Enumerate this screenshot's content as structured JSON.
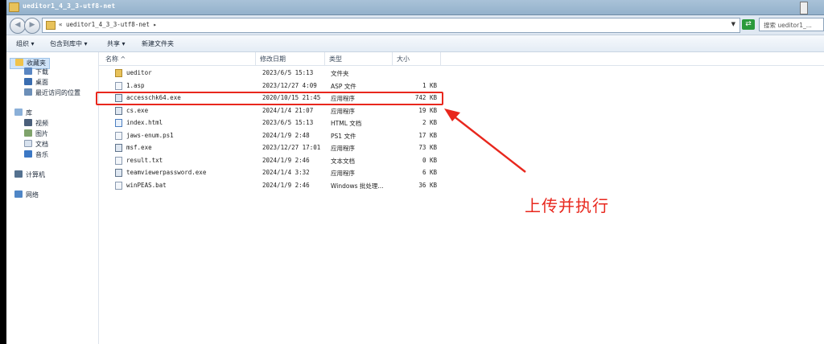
{
  "window": {
    "title": "ueditor1_4_3_3-utf8-net"
  },
  "address": {
    "path": "« ueditor1_4_3_3-utf8-net ▸",
    "search_placeholder": "搜索 ueditor1_..."
  },
  "toolbar": {
    "organize": "组织 ▾",
    "include": "包含到库中 ▾",
    "share": "共享 ▾",
    "new_folder": "新建文件夹"
  },
  "sidebar": {
    "favorites": "收藏夹",
    "downloads": "下载",
    "desktop": "桌面",
    "recent": "最近访问的位置",
    "libraries": "库",
    "videos": "视频",
    "pictures": "图片",
    "documents": "文档",
    "music": "音乐",
    "computer": "计算机",
    "network": "网络"
  },
  "columns": {
    "name": "名称 ^",
    "date": "修改日期",
    "type": "类型",
    "size": "大小"
  },
  "files": [
    {
      "name": "ueditor",
      "date": "2023/6/5 15:13",
      "type": "文件夹",
      "size": "",
      "icon": "folder-icon"
    },
    {
      "name": "1.asp",
      "date": "2023/12/27 4:09",
      "type": "ASP 文件",
      "size": "1 KB",
      "icon": "file-icon"
    },
    {
      "name": "accesschk64.exe",
      "date": "2020/10/15 21:45",
      "type": "应用程序",
      "size": "742 KB",
      "icon": "exe-icon"
    },
    {
      "name": "cs.exe",
      "date": "2024/1/4 21:07",
      "type": "应用程序",
      "size": "19 KB",
      "icon": "exe-icon"
    },
    {
      "name": "index.html",
      "date": "2023/6/5 15:13",
      "type": "HTML 文档",
      "size": "2 KB",
      "icon": "html-icon"
    },
    {
      "name": "jaws-enum.ps1",
      "date": "2024/1/9 2:48",
      "type": "PS1 文件",
      "size": "17 KB",
      "icon": "file-icon"
    },
    {
      "name": "msf.exe",
      "date": "2023/12/27 17:01",
      "type": "应用程序",
      "size": "73 KB",
      "icon": "exe-icon"
    },
    {
      "name": "result.txt",
      "date": "2024/1/9 2:46",
      "type": "文本文档",
      "size": "0 KB",
      "icon": "file-icon"
    },
    {
      "name": "teamviewerpassword.exe",
      "date": "2024/1/4 3:32",
      "type": "应用程序",
      "size": "6 KB",
      "icon": "exe-icon"
    },
    {
      "name": "winPEAS.bat",
      "date": "2024/1/9 2:46",
      "type": "Windows 批处理...",
      "size": "36 KB",
      "icon": "file-icon"
    }
  ],
  "annotation": {
    "text": "上传并执行",
    "color": "#e8271d"
  }
}
